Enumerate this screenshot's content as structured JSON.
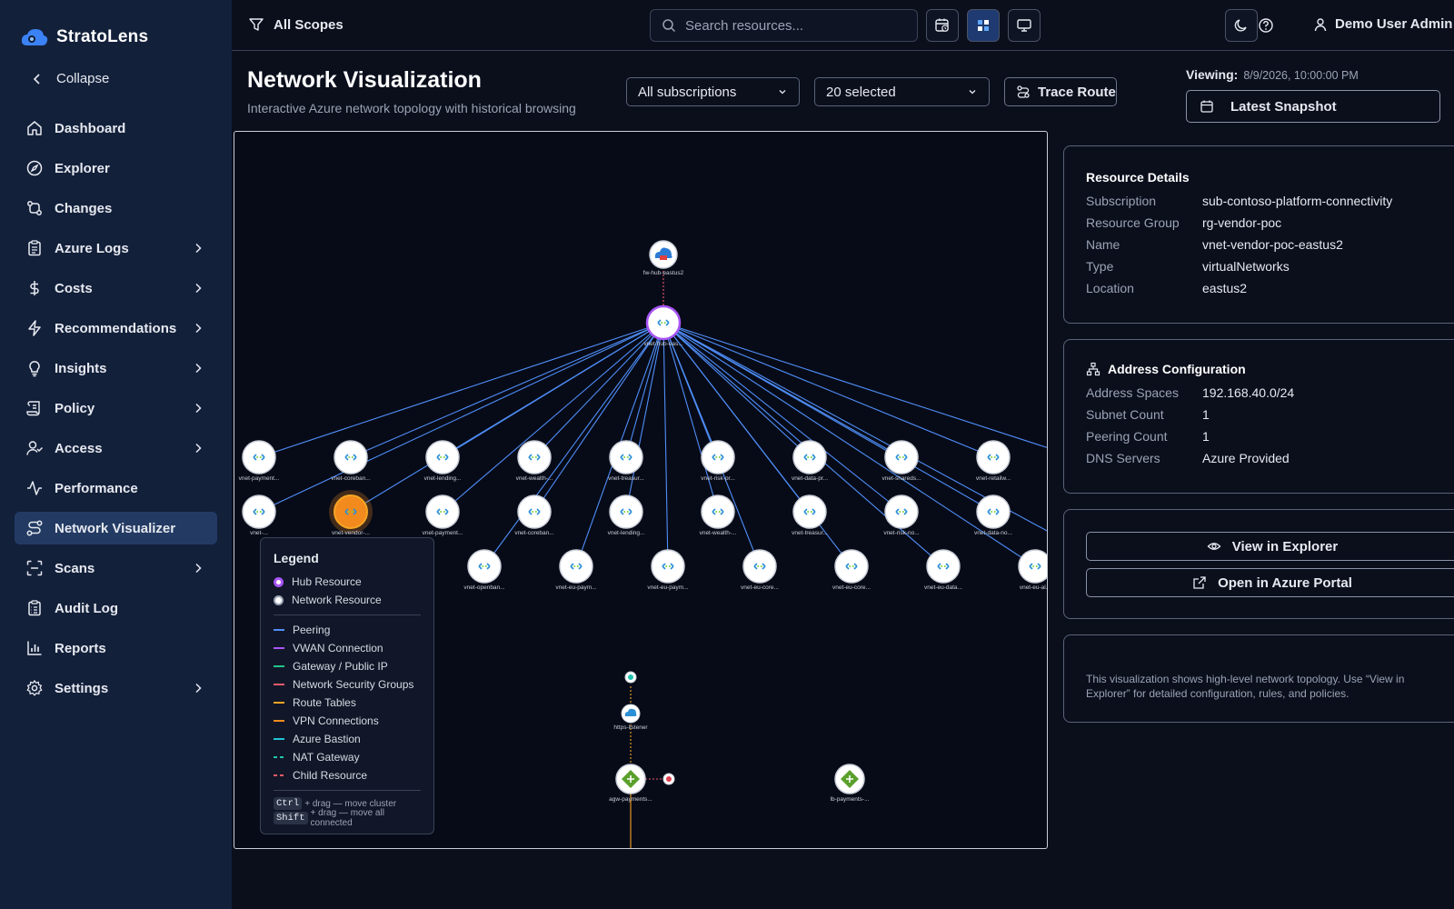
{
  "brand": {
    "name": "StratoLens"
  },
  "sidebar": {
    "collapse_label": "Collapse",
    "items": [
      {
        "label": "Dashboard",
        "icon": "home-icon",
        "has_children": false
      },
      {
        "label": "Explorer",
        "icon": "compass-icon",
        "has_children": false
      },
      {
        "label": "Changes",
        "icon": "git-compare-icon",
        "has_children": false
      },
      {
        "label": "Azure Logs",
        "icon": "clipboard-icon",
        "has_children": true
      },
      {
        "label": "Costs",
        "icon": "dollar-icon",
        "has_children": true
      },
      {
        "label": "Recommendations",
        "icon": "zap-icon",
        "has_children": true
      },
      {
        "label": "Insights",
        "icon": "lightbulb-icon",
        "has_children": true
      },
      {
        "label": "Policy",
        "icon": "scroll-icon",
        "has_children": true
      },
      {
        "label": "Access",
        "icon": "user-check-icon",
        "has_children": true
      },
      {
        "label": "Performance",
        "icon": "activity-icon",
        "has_children": false
      },
      {
        "label": "Network Visualizer",
        "icon": "route-icon",
        "has_children": false,
        "active": true
      },
      {
        "label": "Scans",
        "icon": "scan-icon",
        "has_children": true
      },
      {
        "label": "Audit Log",
        "icon": "clipboard-list-icon",
        "has_children": false
      },
      {
        "label": "Reports",
        "icon": "bar-chart-icon",
        "has_children": false
      },
      {
        "label": "Settings",
        "icon": "gear-icon",
        "has_children": true
      }
    ]
  },
  "topbar": {
    "scope_label": "All Scopes",
    "search_placeholder": "Search resources..."
  },
  "user": {
    "name": "Demo User Admin"
  },
  "page": {
    "title": "Network Visualization",
    "subtitle": "Interactive Azure network topology with historical browsing",
    "subscription_select": "All subscriptions",
    "resource_select": "20 selected",
    "trace_route_label": "Trace Route",
    "viewing_label": "Viewing:",
    "viewing_timestamp": "8/9/2026, 10:00:00 PM",
    "snapshot_label": "Latest Snapshot"
  },
  "topology": {
    "firewall": {
      "label": "fw-hub-eastus2"
    },
    "hub": {
      "label": "vnet-hub-eas..."
    },
    "row1": [
      "vnet-payment...",
      "vnet-coreban...",
      "vnet-lending...",
      "vnet-wealth-...",
      "vnet-treasur...",
      "vnet-risk-pr...",
      "vnet-data-pr...",
      "vnet-shareds...",
      "vnet-retailw..."
    ],
    "row2": [
      "vnet-...",
      "vnet-vendor-...",
      "vnet-payment...",
      "vnet-coreban...",
      "vnet-lending...",
      "vnet-wealth-...",
      "vnet-treasur...",
      "vnet-risk-no...",
      "vnet-data-no..."
    ],
    "row3": [
      "vnet-openban...",
      "vnet-eu-paym...",
      "vnet-eu-paym...",
      "vnet-eu-core...",
      "vnet-eu-core...",
      "vnet-eu-data...",
      "vnet-eu-al..."
    ],
    "listener": {
      "label": "https-listener"
    },
    "appgw": {
      "label": "agw-payments..."
    },
    "lb": {
      "label": "lb-payments-..."
    }
  },
  "legend": {
    "title": "Legend",
    "nodes": [
      {
        "label": "Hub Resource",
        "kind": "hub"
      },
      {
        "label": "Network Resource",
        "kind": "network"
      }
    ],
    "edges": [
      {
        "label": "Peering",
        "color": "#4f8ef7",
        "dashed": false
      },
      {
        "label": "VWAN Connection",
        "color": "#a855f7",
        "dashed": false
      },
      {
        "label": "Gateway / Public IP",
        "color": "#22c58b",
        "dashed": false
      },
      {
        "label": "Network Security Groups",
        "color": "#f05a6a",
        "dashed": false
      },
      {
        "label": "Route Tables",
        "color": "#f5a524",
        "dashed": false
      },
      {
        "label": "VPN Connections",
        "color": "#f28a1e",
        "dashed": false
      },
      {
        "label": "Azure Bastion",
        "color": "#22c3d6",
        "dashed": false
      },
      {
        "label": "NAT Gateway",
        "color": "#22c3b0",
        "dashed": true
      },
      {
        "label": "Child Resource",
        "color": "#f05a6a",
        "dashed": true
      }
    ],
    "hint1_key": "Ctrl",
    "hint1_text": "+ drag — move cluster",
    "hint2_key": "Shift",
    "hint2_text": "+ drag — move all connected"
  },
  "details": {
    "title": "Resource Details",
    "rows": [
      {
        "k": "Subscription",
        "v": "sub-contoso-platform-connectivity"
      },
      {
        "k": "Resource Group",
        "v": "rg-vendor-poc"
      },
      {
        "k": "Name",
        "v": "vnet-vendor-poc-eastus2"
      },
      {
        "k": "Type",
        "v": "virtualNetworks"
      },
      {
        "k": "Location",
        "v": "eastus2"
      }
    ]
  },
  "address": {
    "title": "Address Configuration",
    "rows": [
      {
        "k": "Address Spaces",
        "v": "192.168.40.0/24"
      },
      {
        "k": "Subnet Count",
        "v": "1"
      },
      {
        "k": "Peering Count",
        "v": "1"
      },
      {
        "k": "DNS Servers",
        "v": "Azure Provided"
      }
    ]
  },
  "actions": {
    "view_explorer": "View in Explorer",
    "open_portal": "Open in Azure Portal"
  },
  "note": "This visualization shows high-level network topology. Use “View in Explorer” for detailed configuration, rules, and policies."
}
